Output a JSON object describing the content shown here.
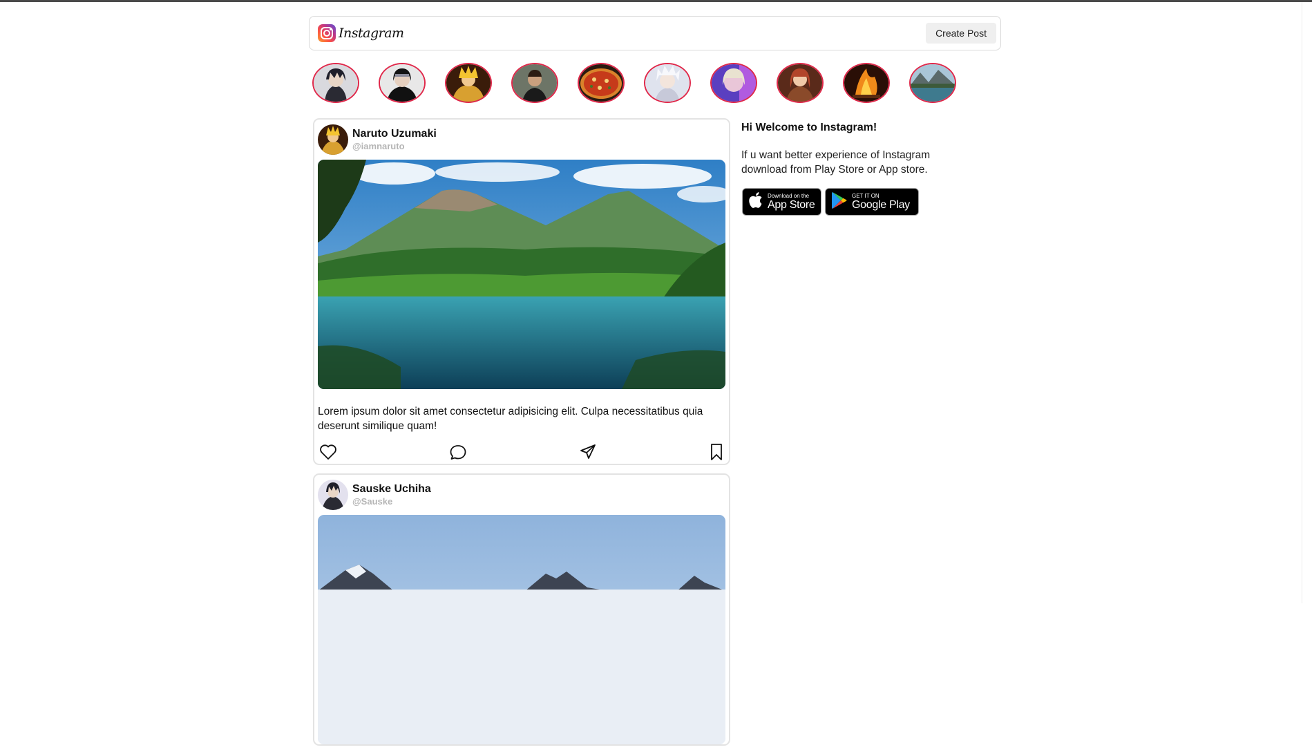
{
  "header": {
    "brand": "Instagram",
    "create_post_label": "Create Post",
    "logo_icon": "instagram-logo-icon"
  },
  "stories": [
    {
      "name": "story-sasuke",
      "color": "#2b2b3a"
    },
    {
      "name": "story-itachi",
      "color": "#151515"
    },
    {
      "name": "story-naruto-sage",
      "color": "#c98a2a"
    },
    {
      "name": "story-man-portrait",
      "color": "#4b5548"
    },
    {
      "name": "story-pizza",
      "color": "#c44a1f"
    },
    {
      "name": "story-killua",
      "color": "#c9cfe0"
    },
    {
      "name": "story-girl-neon",
      "color": "#8a5ad6"
    },
    {
      "name": "story-redhead-girl",
      "color": "#8a3a22"
    },
    {
      "name": "story-campfire",
      "color": "#e0651a"
    },
    {
      "name": "story-lake",
      "color": "#3f6f8a"
    }
  ],
  "posts": [
    {
      "author": "Naruto Uzumaki",
      "handle": "@iamnaruto",
      "caption": "Lorem ipsum dolor sit amet consectetur adipisicing elit. Culpa necessitatibus quia deserunt similique quam!",
      "image": "mountain-lake-forest"
    },
    {
      "author": "Sauske Uchiha",
      "handle": "@Sauske",
      "caption": "",
      "image": "snowy-mountains"
    }
  ],
  "sidebar": {
    "welcome": "Hi Welcome to Instagram!",
    "info": "If u want better experience of Instagram download from Play Store or App store.",
    "app_store": {
      "small": "Download on the",
      "big": "App Store"
    },
    "google_play": {
      "small": "GET IT ON",
      "big": "Google Play"
    }
  },
  "icons": [
    "heart-icon",
    "comment-icon",
    "share-icon",
    "bookmark-icon",
    "apple-icon",
    "google-play-icon"
  ]
}
